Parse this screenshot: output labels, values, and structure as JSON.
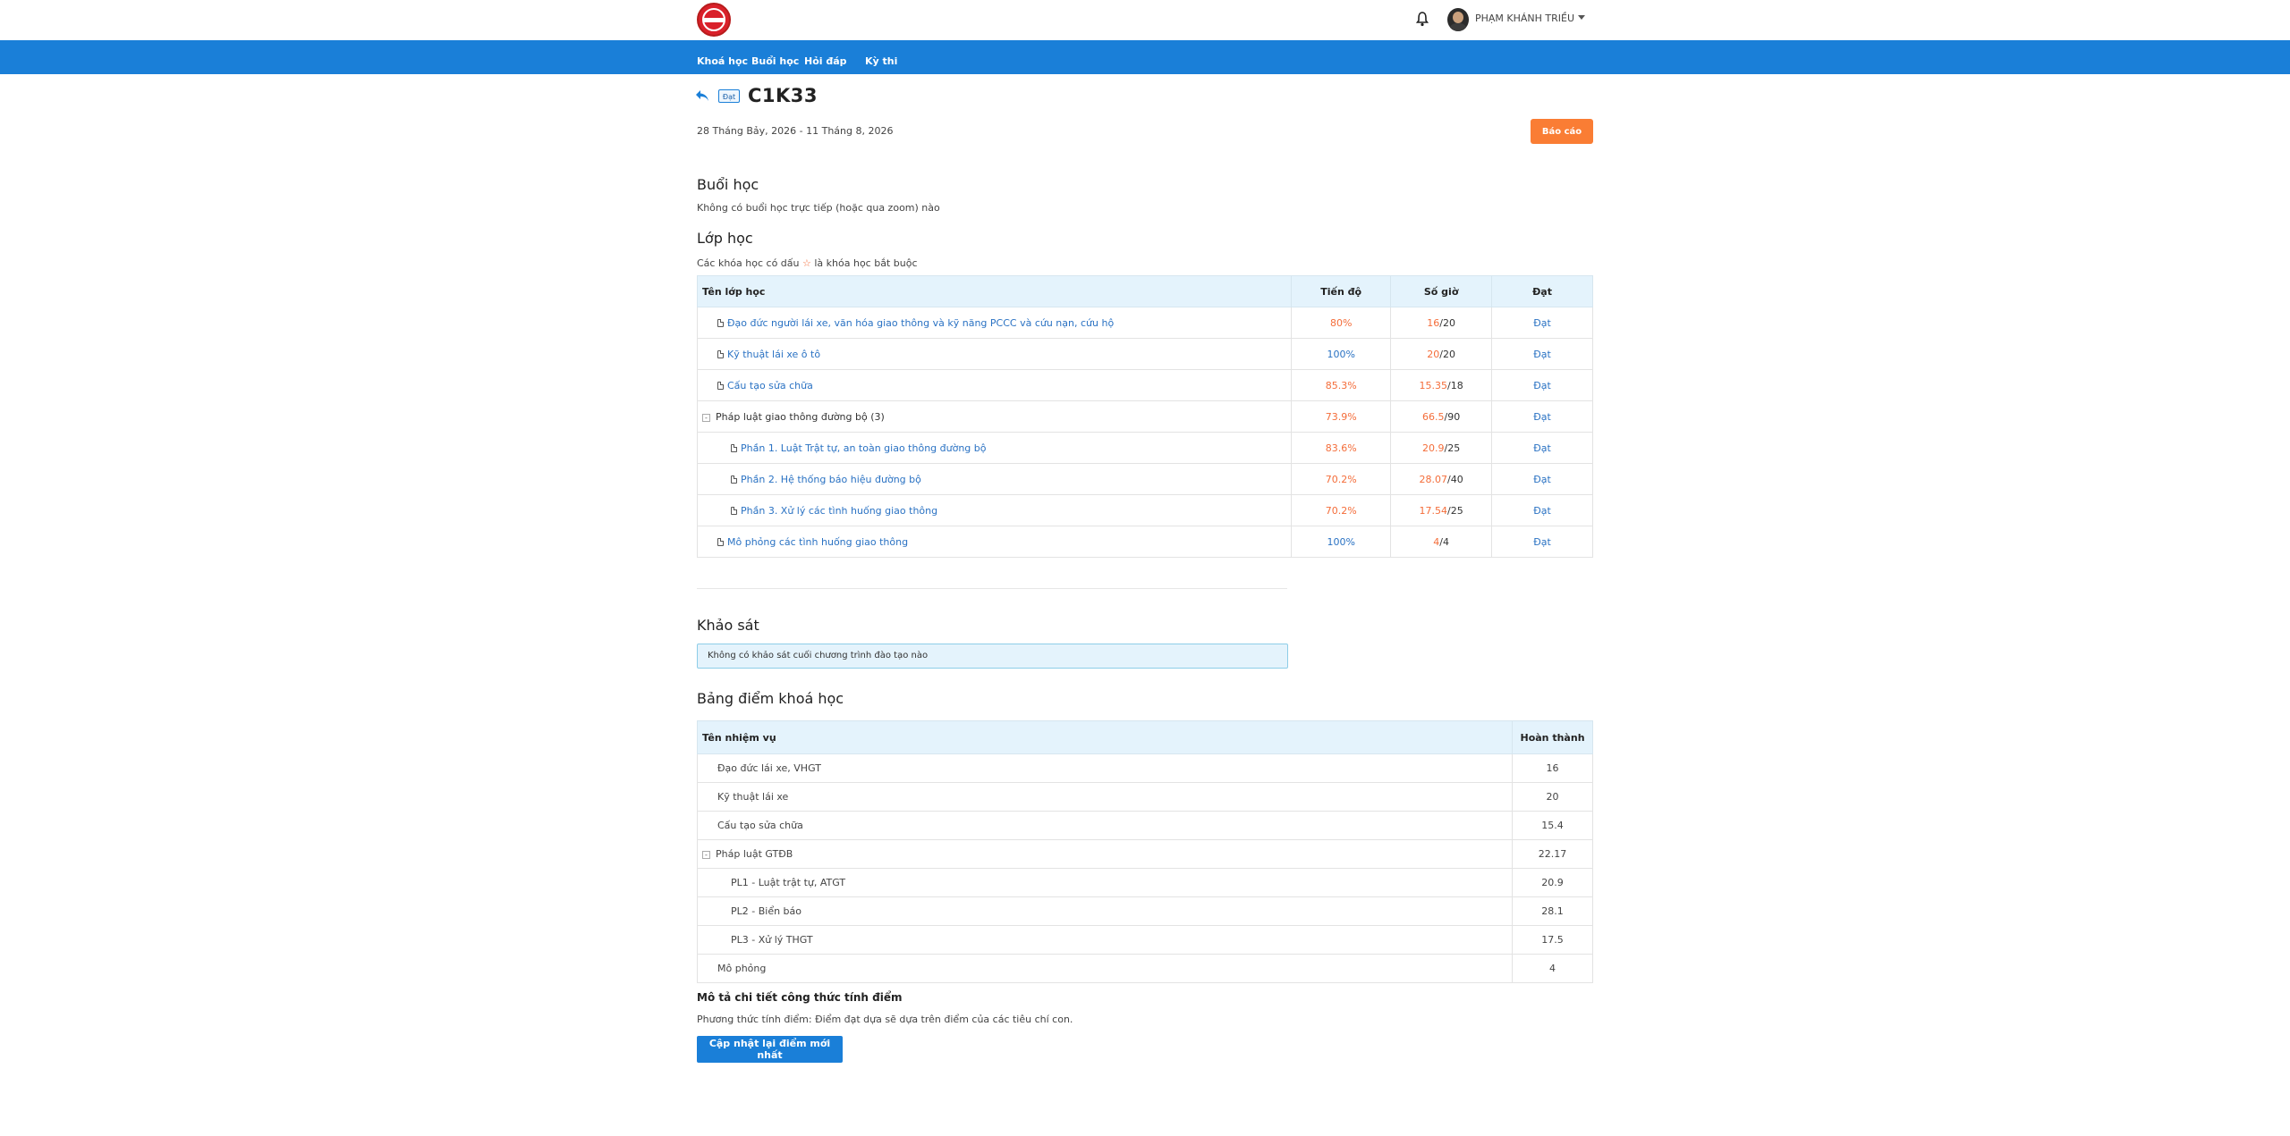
{
  "header": {
    "username": "PHẠM KHÁNH TRIỀU"
  },
  "nav": [
    {
      "label": "Khoá học"
    },
    {
      "label": "Buổi học"
    },
    {
      "label": "Hỏi đáp"
    },
    {
      "label": "Kỳ thi"
    }
  ],
  "course": {
    "status_badge": "Đạt",
    "title": "C1K33",
    "date_range": "28 Tháng Bảy, 2026 - 11 Tháng 8, 2026",
    "report_button": "Báo cáo"
  },
  "sessions": {
    "heading": "Buổi học",
    "empty_text": "Không có buổi học trực tiếp (hoặc qua zoom) nào"
  },
  "classes": {
    "heading": "Lớp học",
    "note_prefix": "Các khóa học có dấu",
    "note_star": "☆",
    "note_suffix": "là khóa học bắt buộc",
    "columns": [
      "Tên lớp học",
      "Tiến độ",
      "Số giờ",
      "Đạt"
    ],
    "rows": [
      {
        "name": "Đạo đức người lái xe, văn hóa giao thông và kỹ năng PCCC và cứu nạn, cứu hộ",
        "progress": "80%",
        "hours_done": "16",
        "hours_total": "/20",
        "status": "Đạt"
      },
      {
        "name": "Kỹ thuật lái xe ô tô",
        "progress": "100%",
        "hours_done": "20",
        "hours_total": "/20",
        "status": "Đạt"
      },
      {
        "name": "Cấu tạo sửa chữa",
        "progress": "85.3%",
        "hours_done": "15.35",
        "hours_total": "/18",
        "status": "Đạt"
      },
      {
        "name": "Pháp luật giao thông đường bộ",
        "count": "(3)",
        "toggle": "-",
        "progress": "73.9%",
        "hours_done": "66.5",
        "hours_total": "/90",
        "status": "Đạt"
      },
      {
        "name": "Phần 1. Luật Trật tự, an toàn giao thông đường bộ",
        "progress": "83.6%",
        "hours_done": "20.9",
        "hours_total": "/25",
        "status": "Đạt"
      },
      {
        "name": "Phần 2. Hệ thống báo hiệu đường bộ",
        "progress": "70.2%",
        "hours_done": "28.07",
        "hours_total": "/40",
        "status": "Đạt"
      },
      {
        "name": "Phần 3. Xử lý các tình huống giao thông",
        "progress": "70.2%",
        "hours_done": "17.54",
        "hours_total": "/25",
        "status": "Đạt"
      },
      {
        "name": "Mô phỏng các tình huống giao thông",
        "progress": "100%",
        "hours_done": "4",
        "hours_total": "/4",
        "status": "Đạt"
      }
    ]
  },
  "survey": {
    "heading": "Khảo sát",
    "empty_text": "Không có khảo sát cuối chương trình đào tạo nào"
  },
  "grades": {
    "heading": "Bảng điểm khoá học",
    "columns": [
      "Tên nhiệm vụ",
      "Hoàn thành"
    ],
    "rows": [
      {
        "name": "Đạo đức lái xe, VHGT",
        "score": "16"
      },
      {
        "name": "Kỹ thuật lái xe",
        "score": "20"
      },
      {
        "name": "Cấu tạo sửa chữa",
        "score": "15.4"
      },
      {
        "name": "Pháp luật GTĐB",
        "toggle": "-",
        "score": "22.17"
      },
      {
        "name": "PL1 - Luật trật tự, ATGT",
        "score": "20.9"
      },
      {
        "name": "PL2 - Biển báo",
        "score": "28.1"
      },
      {
        "name": "PL3 - Xử lý THGT",
        "score": "17.5"
      },
      {
        "name": "Mô phỏng",
        "score": "4"
      }
    ]
  },
  "formula": {
    "title": "Mô tả chi tiết công thức tính điểm",
    "text": "Phương thức tính điểm: Điểm đạt dựa sẽ dựa trên điểm của các tiêu chí con.",
    "update_button": "Cập nhật lại điểm mới nhất"
  },
  "colors": {
    "nav_blue": "#1a7fd8",
    "accent_orange": "#fa7d34",
    "link_blue": "#2a72c3",
    "table_header_bg": "#e4f3fc"
  }
}
